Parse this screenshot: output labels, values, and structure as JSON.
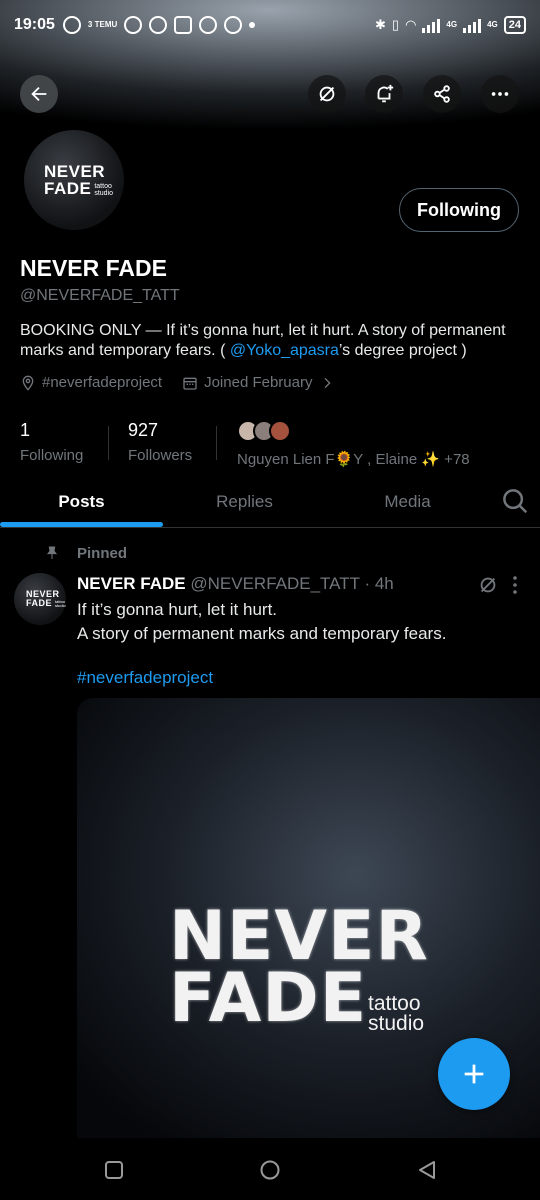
{
  "status_bar": {
    "time": "19:05",
    "temu_label": "3 TEMU",
    "network_1": "4G",
    "network_2": "4G",
    "battery": "24"
  },
  "profile": {
    "name": "NEVER FADE",
    "handle": "@NEVERFADE_TATT",
    "follow_button_label": "Following",
    "avatar_logo_line1": "NEVER",
    "avatar_logo_line2": "FADE",
    "avatar_logo_sub": "tattoo studio",
    "bio_part1": "BOOKING ONLY — If it’s gonna hurt, let it hurt. A story of permanent marks and temporary fears. ( ",
    "bio_mention": "@Yoko_apasra",
    "bio_part2": "’s degree project )",
    "hashtag_meta": "#neverfadeproject",
    "joined": "Joined February",
    "following_count": "1",
    "following_label": "Following",
    "followers_count": "927",
    "followers_label": "Followers",
    "followed_by_text": "Nguyen Lien F🌻Y  , Elaine ✨ +78"
  },
  "tabs": [
    {
      "label": "Posts"
    },
    {
      "label": "Replies"
    },
    {
      "label": "Media"
    }
  ],
  "post": {
    "pinned_label": "Pinned",
    "author_name": "NEVER FADE",
    "author_handle": "@NEVERFADE_TATT",
    "time": "· 4h",
    "line1": "If it’s gonna hurt, let it hurt.",
    "line2": "A story of permanent marks and temporary fears.",
    "hashtag": "#neverfadeproject",
    "image_title_1": "NEVER",
    "image_title_2": "FADE",
    "image_sub_1": "tattoo",
    "image_sub_2": "studio"
  },
  "colors": {
    "accent": "#1d9bf0",
    "muted": "#71767b",
    "background": "#000000"
  },
  "icons": {
    "back": "arrow-left-icon",
    "grok": "grok-icon",
    "notify": "bell-plus-icon",
    "share": "share-icon",
    "more": "more-horizontal-icon",
    "search": "search-icon",
    "compose": "plus-icon"
  }
}
